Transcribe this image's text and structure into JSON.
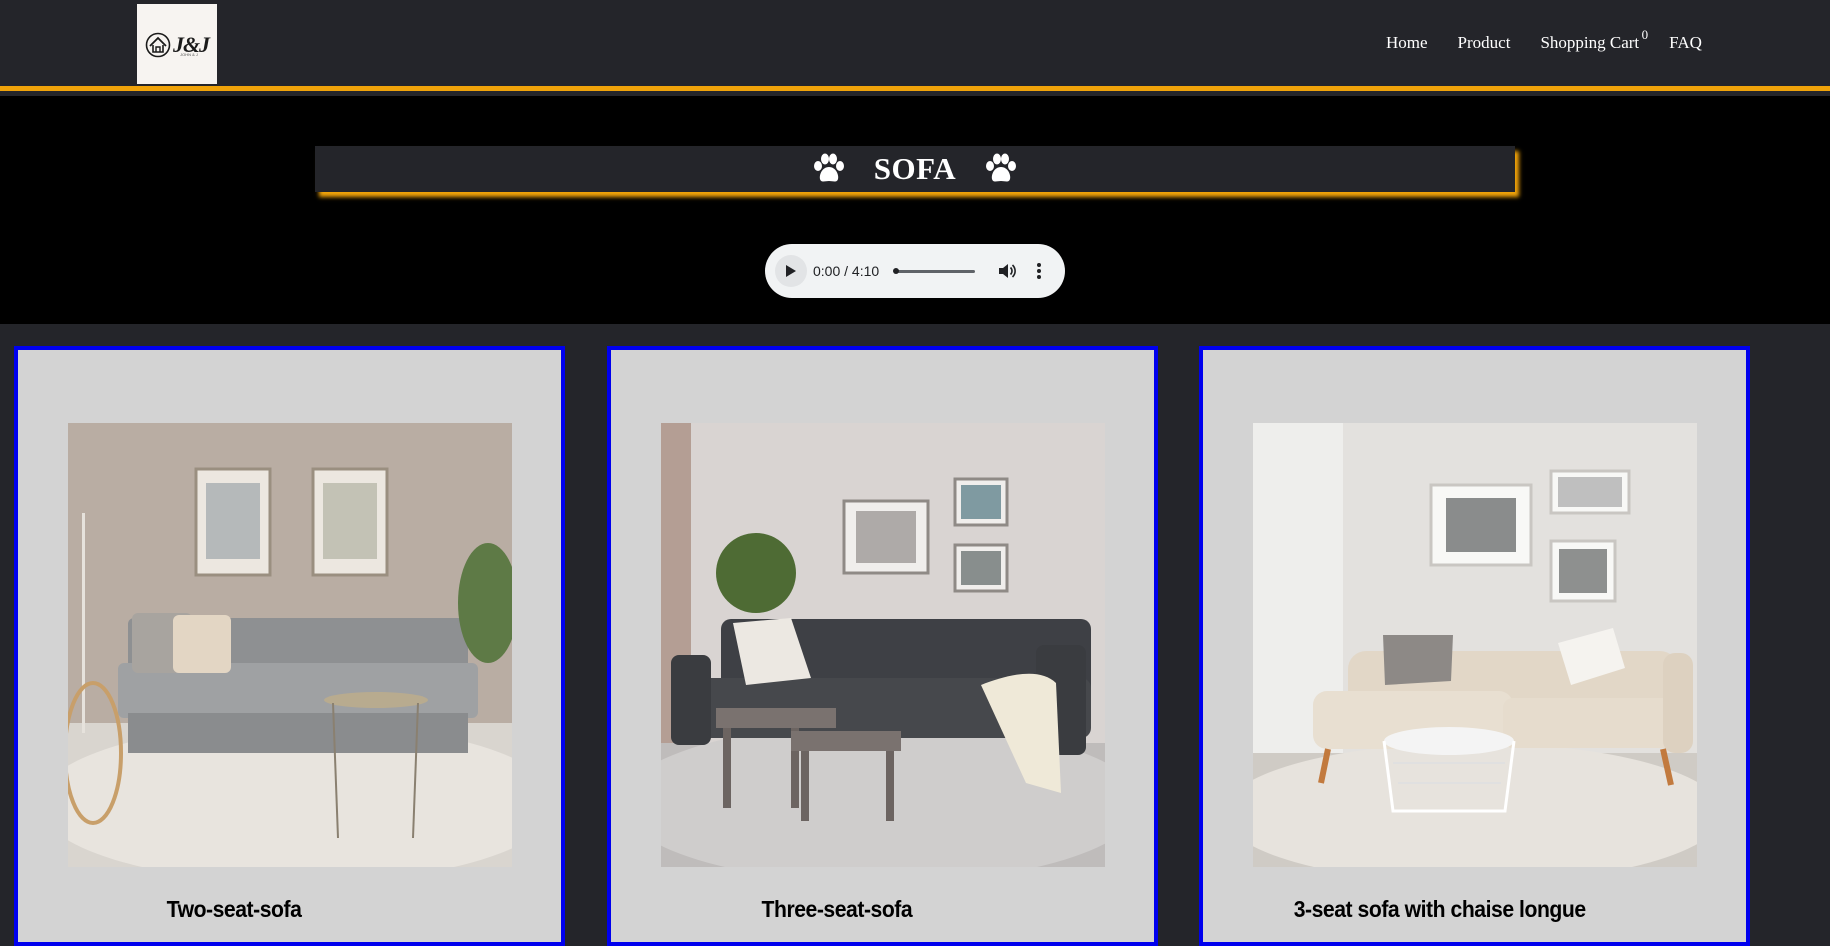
{
  "header": {
    "logo_text": "J&J",
    "logo_subtext": "JOHN & J",
    "nav": {
      "home": "Home",
      "product": "Product",
      "cart": "Shopping Cart",
      "cart_count": "0",
      "faq": "FAQ"
    }
  },
  "hero": {
    "title": "SOFA",
    "audio": {
      "time": "0:00 / 4:10"
    }
  },
  "products": [
    {
      "name": "Two-seat-sofa",
      "image": "grey two-seat sofa in living room"
    },
    {
      "name": "Three-seat-sofa",
      "image": "dark grey three-seat sofa in living room"
    },
    {
      "name": "3-seat sofa with chaise longue",
      "image": "beige sofa with chaise longue"
    }
  ],
  "colors": {
    "header_bg": "#24252a",
    "accent": "#f0a30a",
    "card_bg": "#d3d3d3",
    "card_border": "#0000ee"
  }
}
